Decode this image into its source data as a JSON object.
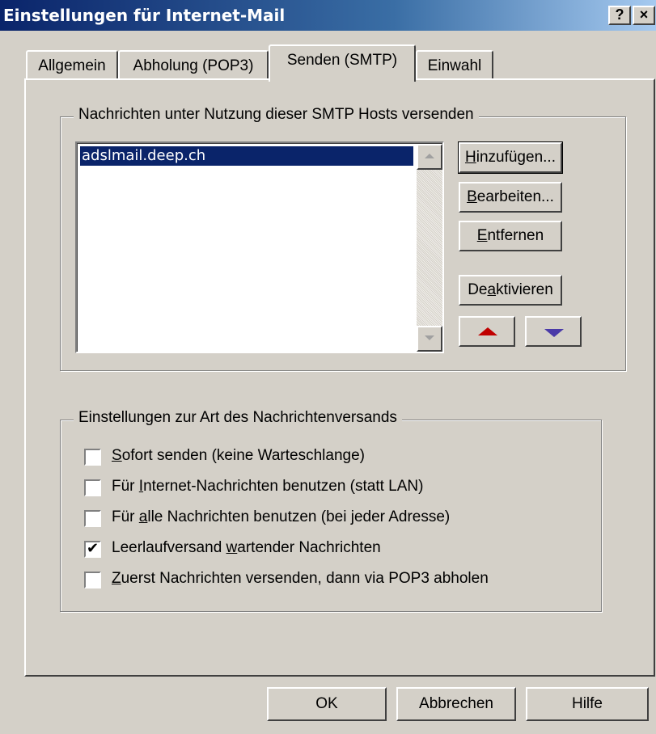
{
  "window": {
    "title": "Einstellungen für Internet-Mail",
    "help_button": "?",
    "close_button": "×"
  },
  "tabs": [
    {
      "label": "Allgemein",
      "active": false
    },
    {
      "label": "Abholung (POP3)",
      "active": false
    },
    {
      "label": "Senden (SMTP)",
      "active": true
    },
    {
      "label": "Einwahl",
      "active": false
    }
  ],
  "hosts_group": {
    "legend": "Nachrichten unter Nutzung dieser SMTP Hosts versenden",
    "items": [
      "adslmail.deep.ch"
    ],
    "selected_index": 0,
    "buttons": {
      "add": {
        "pre": "",
        "u": "H",
        "post": "inzufügen..."
      },
      "edit": {
        "pre": "",
        "u": "B",
        "post": "earbeiten..."
      },
      "remove": {
        "pre": "",
        "u": "E",
        "post": "ntfernen"
      },
      "deactivate": {
        "pre": "De",
        "u": "a",
        "post": "ktivieren"
      }
    },
    "move_up_icon": "up-arrow-red",
    "move_down_icon": "down-arrow-blue"
  },
  "send_group": {
    "legend": "Einstellungen zur Art des Nachrichtenversands",
    "options": [
      {
        "pre": "",
        "u": "S",
        "post": "ofort senden (keine Warteschlange)",
        "checked": false
      },
      {
        "pre": "Für ",
        "u": "I",
        "post": "nternet-Nachrichten benutzen (statt LAN)",
        "checked": false
      },
      {
        "pre": "Für ",
        "u": "a",
        "post": "lle Nachrichten benutzen (bei jeder Adresse)",
        "checked": false
      },
      {
        "pre": "Leerlaufversand ",
        "u": "w",
        "post": "artender Nachrichten",
        "checked": true
      },
      {
        "pre": "",
        "u": "Z",
        "post": "uerst Nachrichten versenden, dann via POP3 abholen",
        "checked": false
      }
    ]
  },
  "footer": {
    "ok": "OK",
    "cancel": "Abbrechen",
    "help": "Hilfe"
  }
}
